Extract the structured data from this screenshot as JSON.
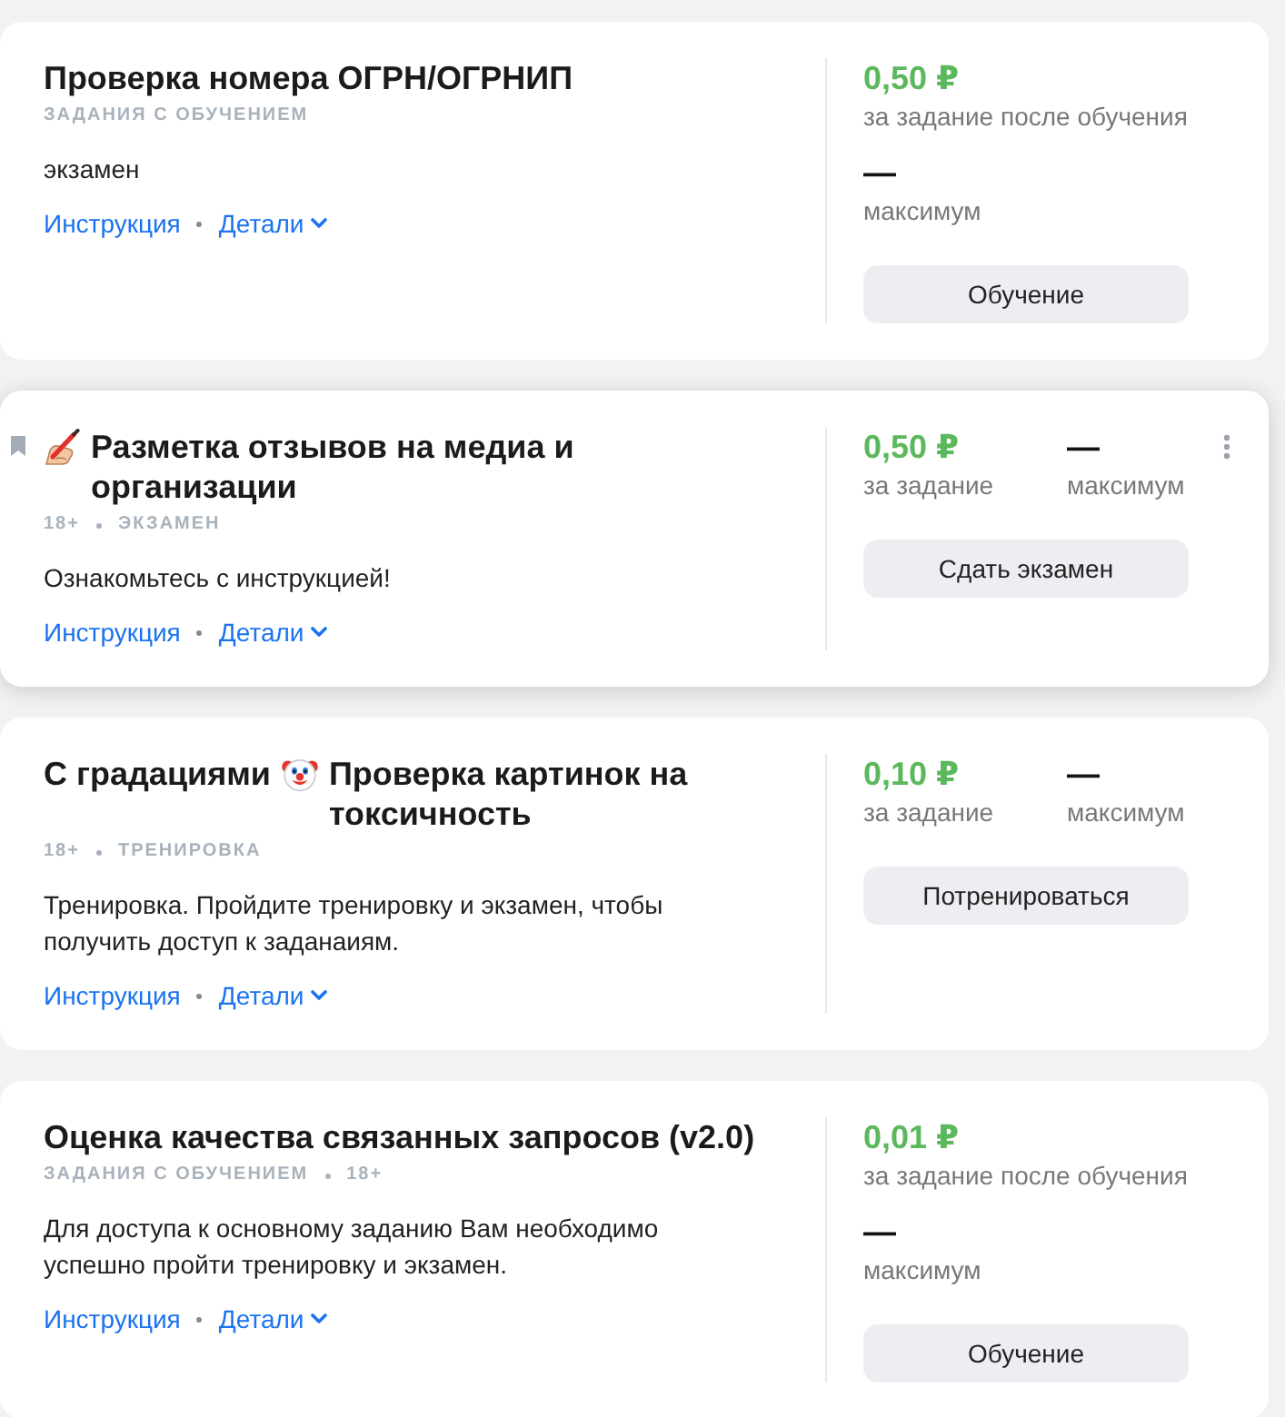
{
  "cards": [
    {
      "hovered": false,
      "title": [
        {
          "kind": "text",
          "text": "Проверка номера ОГРН/ОГРНИП"
        }
      ],
      "tags": [
        "ЗАДАНИЯ С ОБУЧЕНИЕМ"
      ],
      "description": "экзамен",
      "links": {
        "instruction": "Инструкция",
        "details": {
          "label": "Детали",
          "expanded": false
        }
      },
      "reward": {
        "kind": "stacked",
        "price": "0,50 ₽",
        "price_caption": "за задание после обучения",
        "maximum": "—",
        "maximum_caption": "максимум"
      },
      "button": "Обучение"
    },
    {
      "hovered": true,
      "title": [
        {
          "kind": "writing-hand"
        },
        {
          "kind": "text",
          "text": "Разметка отзывов на медиа и организации"
        }
      ],
      "tags": [
        "18+",
        "ЭКЗАМЕН"
      ],
      "description": "Ознакомьтесь с инструкцией!",
      "links": {
        "instruction": "Инструкция",
        "details": {
          "label": "Детали",
          "expanded": false
        }
      },
      "reward": {
        "kind": "side-by-side",
        "price": "0,50 ₽",
        "price_caption": "за задание",
        "maximum": "—",
        "maximum_caption": "максимум"
      },
      "button": "Сдать экзамен"
    },
    {
      "hovered": false,
      "title": [
        {
          "kind": "text",
          "text": "С градациями"
        },
        {
          "kind": "clown"
        },
        {
          "kind": "text",
          "text": "Проверка картинок на токсичность"
        }
      ],
      "tags": [
        "18+",
        "ТРЕНИРОВКА"
      ],
      "description": "Тренировка. Пройдите тренировку и экзамен, чтобы получить доступ к заданаиям.",
      "links": {
        "instruction": "Инструкция",
        "details": {
          "label": "Детали",
          "expanded": false
        }
      },
      "reward": {
        "kind": "side-by-side",
        "price": "0,10 ₽",
        "price_caption": "за задание",
        "maximum": "—",
        "maximum_caption": "максимум"
      },
      "button": "Потренироваться"
    },
    {
      "hovered": false,
      "title": [
        {
          "kind": "text",
          "text": "Оценка качества связанных запросов (v2.0)"
        }
      ],
      "tags": [
        "ЗАДАНИЯ С ОБУЧЕНИЕМ",
        "18+"
      ],
      "description": "Для доступа к основному заданию Вам необходимо успешно пройти тренировку и экзамен.",
      "links": {
        "instruction": "Инструкция",
        "details": {
          "label": "Детали",
          "expanded": false
        }
      },
      "reward": {
        "kind": "stacked",
        "price": "0,01 ₽",
        "price_caption": "за задание после обучения",
        "maximum": "—",
        "maximum_caption": "максимум"
      },
      "button": "Обучение"
    }
  ]
}
